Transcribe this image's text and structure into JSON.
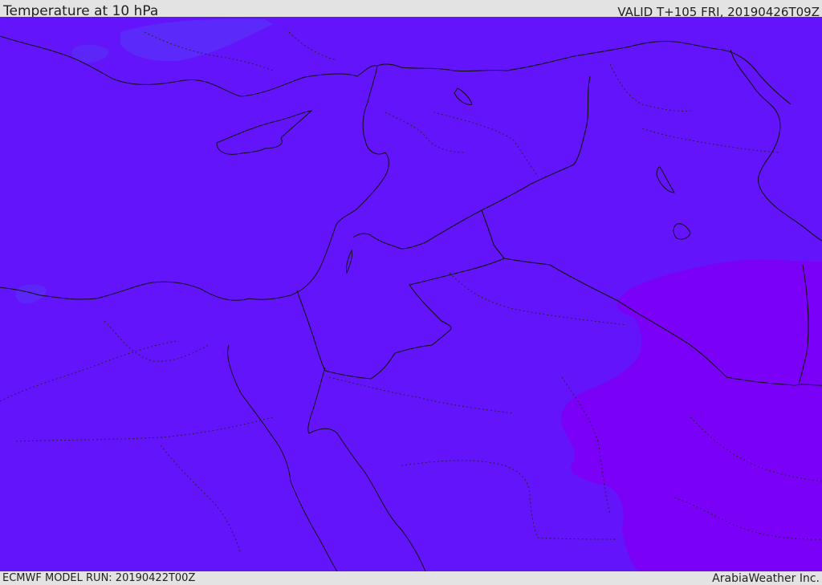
{
  "header": {
    "title": "Temperature at 10 hPa",
    "valid_time": "VALID T+105 FRI, 20190426T09Z"
  },
  "footer": {
    "model_run": "ECMWF MODEL RUN: 20190422T00Z",
    "credit": "ArabiaWeather Inc."
  },
  "map": {
    "field": "temperature",
    "level": "10 hPa",
    "colors": {
      "base_fill": "#6414fa",
      "warm_fill": "#7a00f8",
      "cool_fill": "#5a2bf8",
      "border_line": "#111111",
      "internal_border_line": "#222222"
    }
  }
}
